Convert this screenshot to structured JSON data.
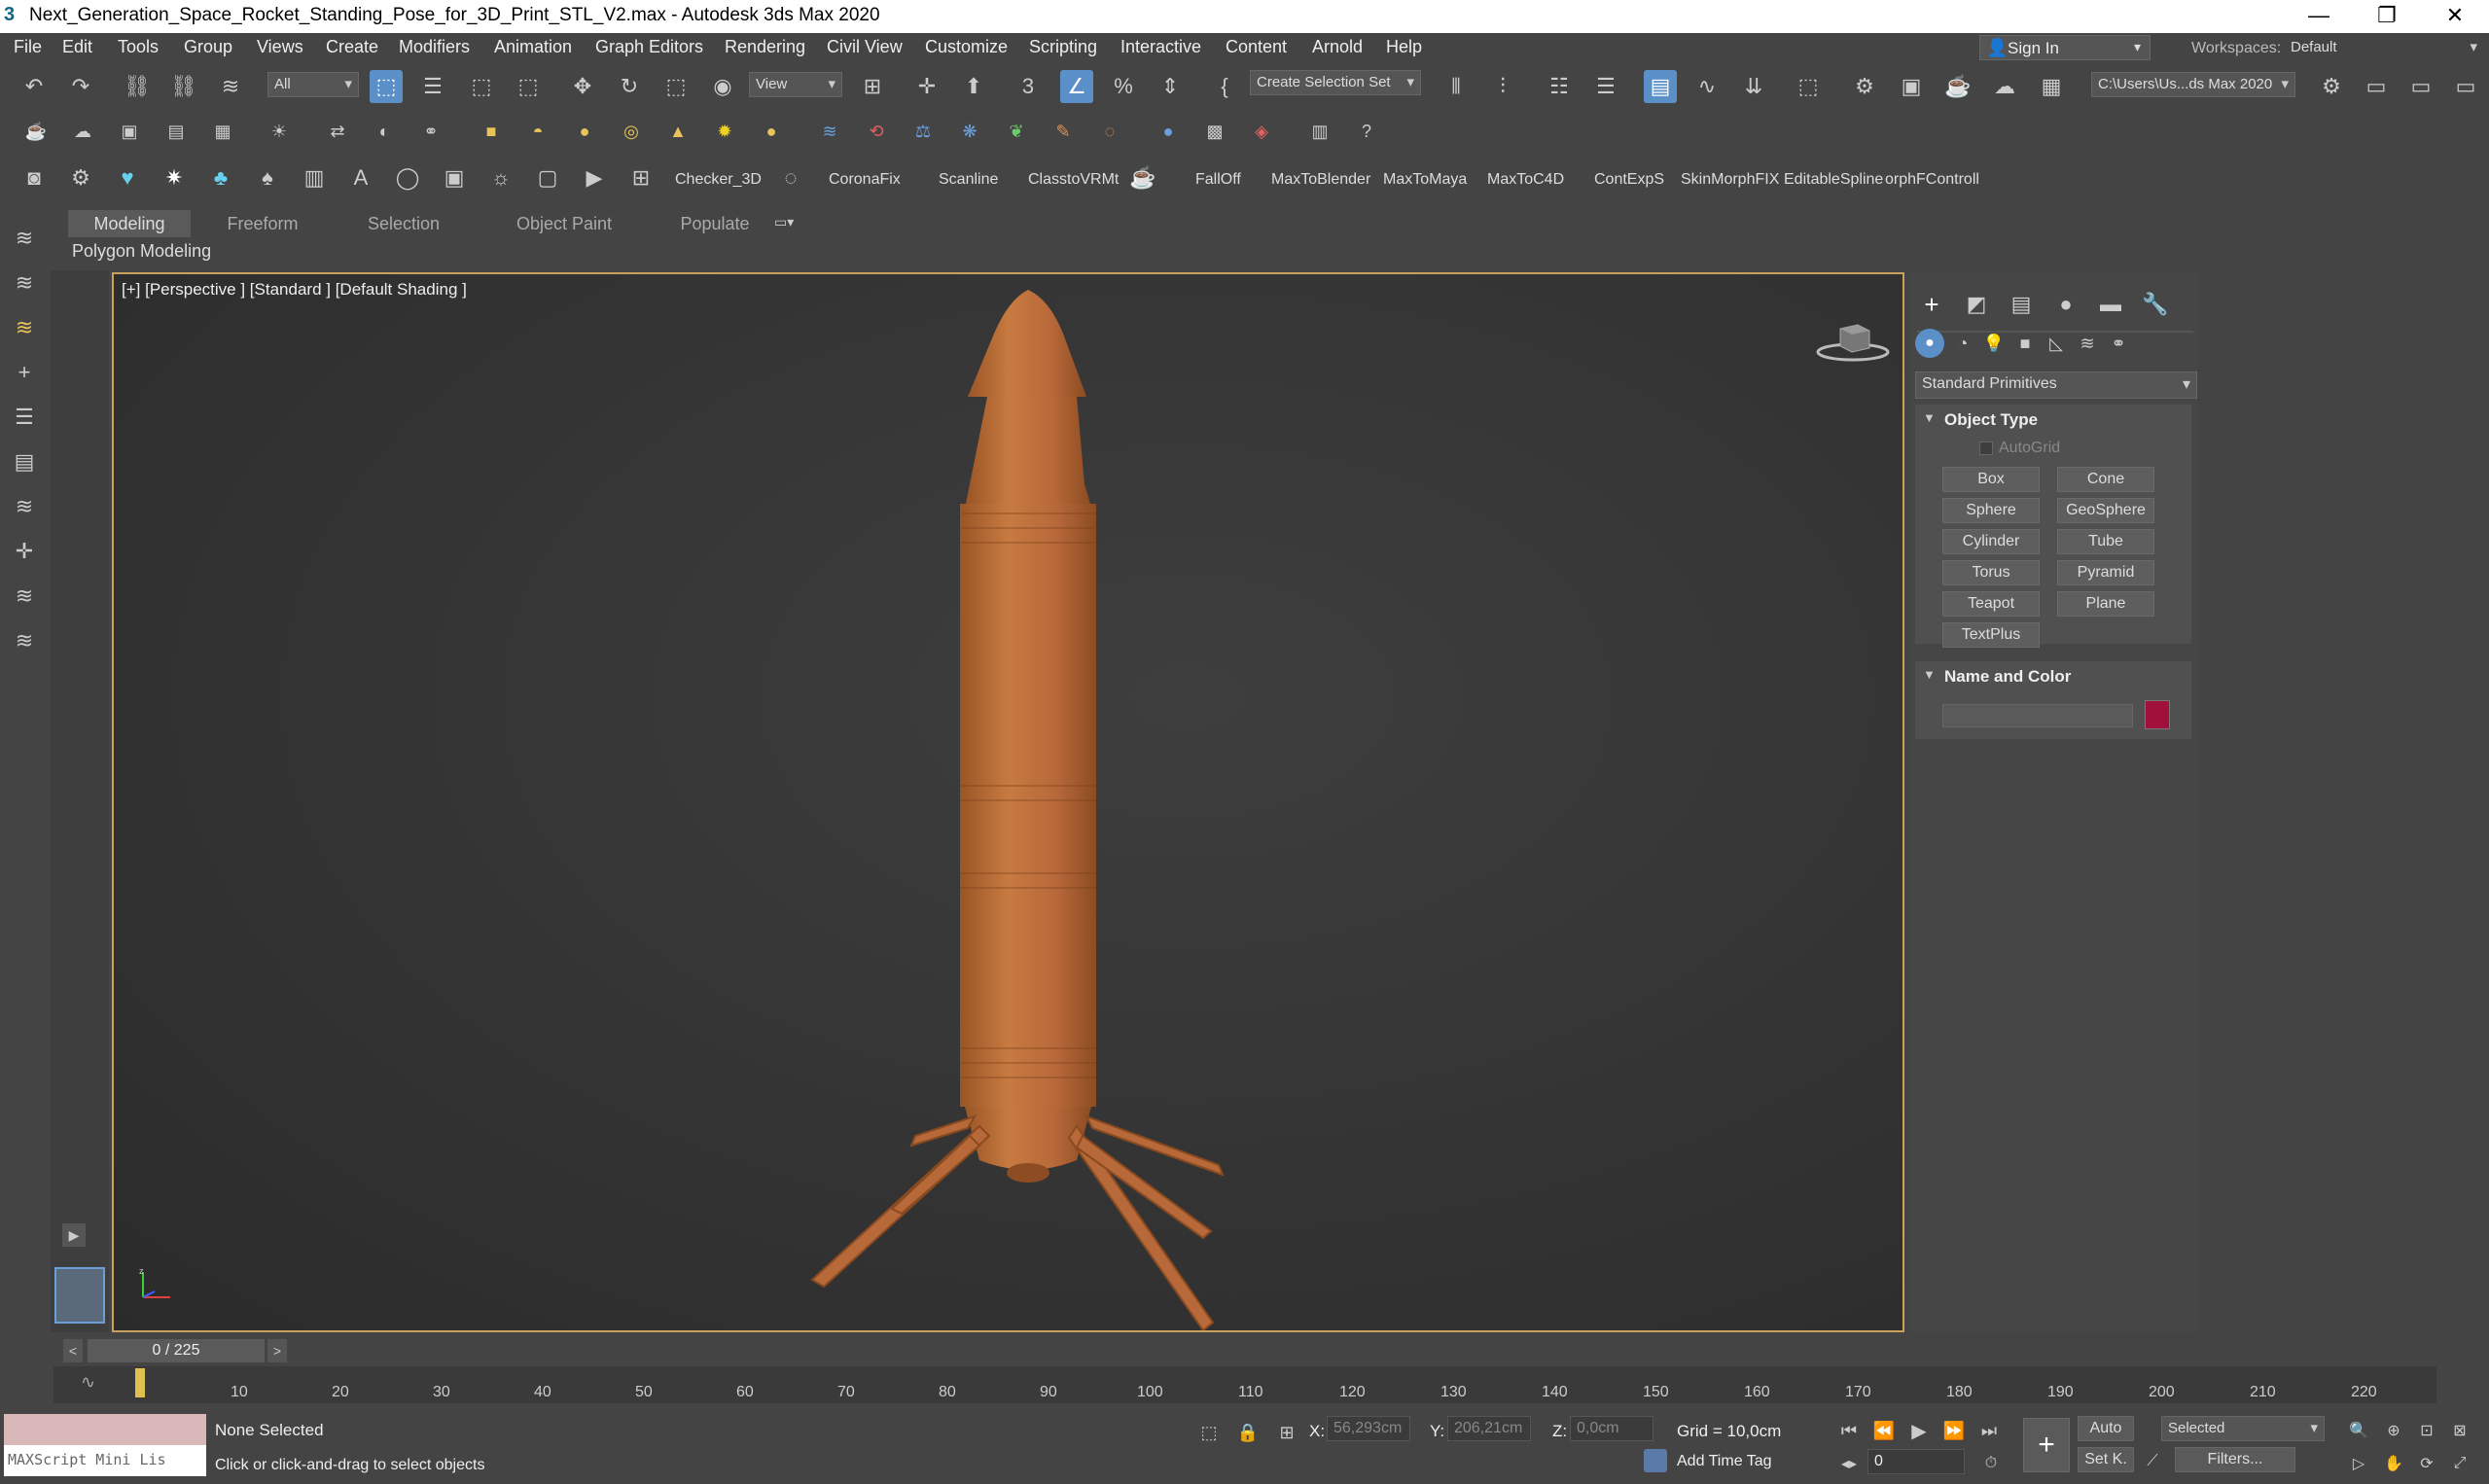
{
  "window": {
    "title": "Next_Generation_Space_Rocket_Standing_Pose_for_3D_Print_STL_V2.max - Autodesk 3ds Max 2020",
    "minimize": "—",
    "restore": "❐",
    "close": "✕"
  },
  "menubar": {
    "items": [
      "File",
      "Edit",
      "Tools",
      "Group",
      "Views",
      "Create",
      "Modifiers",
      "Animation",
      "Graph Editors",
      "Rendering",
      "Civil View",
      "Customize",
      "Scripting",
      "Interactive",
      "Content",
      "Arnold",
      "Help"
    ],
    "sign_in": "Sign In",
    "workspaces_label": "Workspaces:",
    "workspace_value": "Default"
  },
  "toolbar": {
    "selection_filter": "All",
    "ref_coord": "View",
    "selection_set": "Create Selection Set",
    "project_path": "C:\\Users\\Us...ds Max 2020"
  },
  "toolbar3": {
    "labels": [
      "Checker_3D",
      "CoronaFix",
      "Scanline",
      "ClasstoVRMt",
      "FallOff",
      "MaxToBlender",
      "MaxToMaya",
      "MaxToC4D",
      "ContExpS",
      "SkinMorphFIX",
      "EditableSpline",
      "orphFControll"
    ]
  },
  "ribbon": {
    "tabs": [
      "Modeling",
      "Freeform",
      "Selection",
      "Object Paint",
      "Populate"
    ],
    "active_tab": "Modeling",
    "panel_label": "Polygon Modeling"
  },
  "viewport": {
    "label": "[+] [Perspective ] [Standard ] [Default Shading ]",
    "model_color": "#c0723a"
  },
  "command_panel": {
    "category": "Standard Primitives",
    "object_type_title": "Object Type",
    "autogrid": "AutoGrid",
    "buttons": [
      "Box",
      "Cone",
      "Sphere",
      "GeoSphere",
      "Cylinder",
      "Tube",
      "Torus",
      "Pyramid",
      "Teapot",
      "Plane",
      "TextPlus"
    ],
    "name_color_title": "Name and Color",
    "object_name": "",
    "swatch_color": "#a0103a"
  },
  "timeline": {
    "frame_display": "0 / 225",
    "ticks": [
      "10",
      "20",
      "30",
      "40",
      "50",
      "60",
      "70",
      "80",
      "90",
      "100",
      "110",
      "120",
      "130",
      "140",
      "150",
      "160",
      "170",
      "180",
      "190",
      "200",
      "210",
      "220"
    ]
  },
  "status": {
    "selection": "None Selected",
    "prompt": "Click or click-and-drag to select objects",
    "maxscript": "MAXScript Mini Lis",
    "x_label": "X:",
    "x_value": "56,293cm",
    "y_label": "Y:",
    "y_value": "206,21cm",
    "z_label": "Z:",
    "z_value": "0,0cm",
    "grid": "Grid = 10,0cm",
    "add_time_tag": "Add Time Tag",
    "auto": "Auto",
    "set_key": "Set K.",
    "key_mode": "Selected",
    "filters": "Filters...",
    "current_frame": "0"
  }
}
